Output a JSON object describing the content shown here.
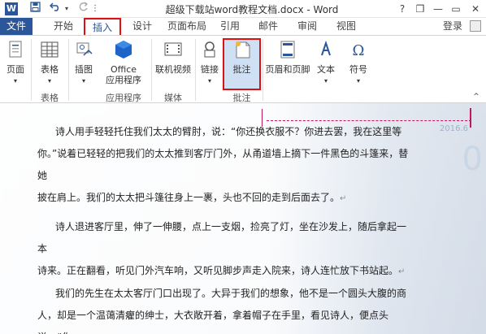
{
  "titlebar": {
    "app_icon": "W",
    "save_icon": "save-icon",
    "undo_icon": "undo-icon",
    "redo_icon": "redo-icon",
    "title": "超级下载站word教程文档.docx - Word",
    "help": "?",
    "minimize": "—",
    "restore": "❐",
    "maximize": "▭",
    "close": "✕"
  },
  "tabs": {
    "file": "文件",
    "home": "开始",
    "insert": "插入",
    "design": "设计",
    "layout": "页面布局",
    "references": "引用",
    "mailings": "邮件",
    "review": "审阅",
    "view": "视图",
    "login": "登录"
  },
  "ribbon": {
    "page": "页面",
    "table": "表格",
    "illustrations": "插图",
    "office_apps_line1": "Office",
    "office_apps_line2": "应用程序",
    "online_video": "联机视频",
    "links": "链接",
    "comment": "批注",
    "header_footer": "页眉和页脚",
    "text": "文本",
    "symbols": "符号",
    "groups": {
      "table": "表格",
      "apps": "应用程序",
      "media": "媒体",
      "comments": "批注"
    }
  },
  "document": {
    "para1_line1": "诗人用手轻轻托住我们太太的臂肘，说：“你还换衣服不？你进去罢，我在这里等",
    "para1_line2": "你。”说着已轻轻的把我们的太太推到客厅门外，从甬道墙上摘下一件黑色的斗篷来，替她",
    "para1_line3": "披在肩上。我们的太太把斗篷往身上一裹，头也不回的走到后面去了。",
    "para2_line1": "诗人退进客厅里，伸了一伸腰，点上一支烟，捡亮了灯，坐在沙发上，随后拿起一本",
    "para2_line2": "诗来。正在翻看，听见门外汽车响，又听见脚步声走入院来，诗人连忙放下书站起。",
    "para3_line1": "我们的先生在太太客厅门口出现了。大异于我们的想象，他不是一个圆头大腹的商",
    "para3_line2": "人，却是一个温蔼清癯的绅士，大衣敞开着，拿着帽子在手里，看见诗人，便点头说：“你",
    "deco_date": "2016.6",
    "deco_big": "0"
  }
}
